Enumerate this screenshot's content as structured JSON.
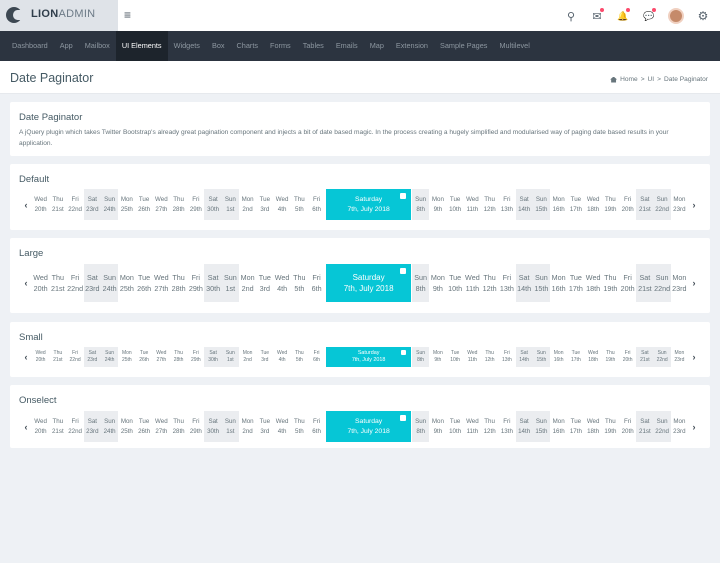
{
  "brand": {
    "bold": "LION",
    "light": "ADMIN"
  },
  "topbar": {
    "icons": [
      {
        "name": "search-icon",
        "glyph": "⚲",
        "dot": false
      },
      {
        "name": "mail-icon",
        "glyph": "✉",
        "dot": true
      },
      {
        "name": "bell-icon",
        "glyph": "🔔",
        "dot": true
      },
      {
        "name": "chat-icon",
        "glyph": "💬",
        "dot": true
      }
    ],
    "settings_glyph": "⚙"
  },
  "nav": [
    {
      "label": "Dashboard",
      "active": false
    },
    {
      "label": "App",
      "active": false
    },
    {
      "label": "Mailbox",
      "active": false
    },
    {
      "label": "UI Elements",
      "active": true
    },
    {
      "label": "Widgets",
      "active": false
    },
    {
      "label": "Box",
      "active": false
    },
    {
      "label": "Charts",
      "active": false
    },
    {
      "label": "Forms",
      "active": false
    },
    {
      "label": "Tables",
      "active": false
    },
    {
      "label": "Emails",
      "active": false
    },
    {
      "label": "Map",
      "active": false
    },
    {
      "label": "Extension",
      "active": false
    },
    {
      "label": "Sample Pages",
      "active": false
    },
    {
      "label": "Multilevel",
      "active": false
    }
  ],
  "page": {
    "title": "Date Paginator",
    "breadcrumb": [
      "Home",
      ">",
      "UI",
      ">",
      "Date Paginator"
    ]
  },
  "intro": {
    "title": "Date Paginator",
    "description": "A jQuery plugin which takes Twitter Bootstrap's already great pagination component and injects a bit of date based magic. In the process creating a hugely simplified and modularised way of paging date based results in your application."
  },
  "paginators": [
    {
      "key": "default",
      "title": "Default"
    },
    {
      "key": "large",
      "title": "Large"
    },
    {
      "key": "small",
      "title": "Small"
    },
    {
      "key": "onselect",
      "title": "Onselect"
    }
  ],
  "arrows": {
    "prev": "‹",
    "next": "›"
  },
  "selected_day": {
    "name": "Saturday",
    "date": "7th, July 2018"
  },
  "days_before": [
    {
      "name": "Wed",
      "date": "20th",
      "weekend": false
    },
    {
      "name": "Thu",
      "date": "21st",
      "weekend": false
    },
    {
      "name": "Fri",
      "date": "22nd",
      "weekend": false
    },
    {
      "name": "Sat",
      "date": "23rd",
      "weekend": true
    },
    {
      "name": "Sun",
      "date": "24th",
      "weekend": true
    },
    {
      "name": "Mon",
      "date": "25th",
      "weekend": false
    },
    {
      "name": "Tue",
      "date": "26th",
      "weekend": false
    },
    {
      "name": "Wed",
      "date": "27th",
      "weekend": false
    },
    {
      "name": "Thu",
      "date": "28th",
      "weekend": false
    },
    {
      "name": "Fri",
      "date": "29th",
      "weekend": false
    },
    {
      "name": "Sat",
      "date": "30th",
      "weekend": true
    },
    {
      "name": "Sun",
      "date": "1st",
      "weekend": true
    },
    {
      "name": "Mon",
      "date": "2nd",
      "weekend": false
    },
    {
      "name": "Tue",
      "date": "3rd",
      "weekend": false
    },
    {
      "name": "Wed",
      "date": "4th",
      "weekend": false
    },
    {
      "name": "Thu",
      "date": "5th",
      "weekend": false
    },
    {
      "name": "Fri",
      "date": "6th",
      "weekend": false
    }
  ],
  "days_after": [
    {
      "name": "Sun",
      "date": "8th",
      "weekend": true
    },
    {
      "name": "Mon",
      "date": "9th",
      "weekend": false
    },
    {
      "name": "Tue",
      "date": "10th",
      "weekend": false
    },
    {
      "name": "Wed",
      "date": "11th",
      "weekend": false
    },
    {
      "name": "Thu",
      "date": "12th",
      "weekend": false
    },
    {
      "name": "Fri",
      "date": "13th",
      "weekend": false
    },
    {
      "name": "Sat",
      "date": "14th",
      "weekend": true
    },
    {
      "name": "Sun",
      "date": "15th",
      "weekend": true
    },
    {
      "name": "Mon",
      "date": "16th",
      "weekend": false
    },
    {
      "name": "Tue",
      "date": "17th",
      "weekend": false
    },
    {
      "name": "Wed",
      "date": "18th",
      "weekend": false
    },
    {
      "name": "Thu",
      "date": "19th",
      "weekend": false
    },
    {
      "name": "Fri",
      "date": "20th",
      "weekend": false
    },
    {
      "name": "Sat",
      "date": "21st",
      "weekend": true
    },
    {
      "name": "Sun",
      "date": "22nd",
      "weekend": true
    },
    {
      "name": "Mon",
      "date": "23rd",
      "weekend": false
    }
  ],
  "colors": {
    "accent": "#06c6d6",
    "nav_bg": "#2c3440",
    "weekend_bg": "#ebedf0",
    "notify_dot": "#fc4b6c"
  }
}
